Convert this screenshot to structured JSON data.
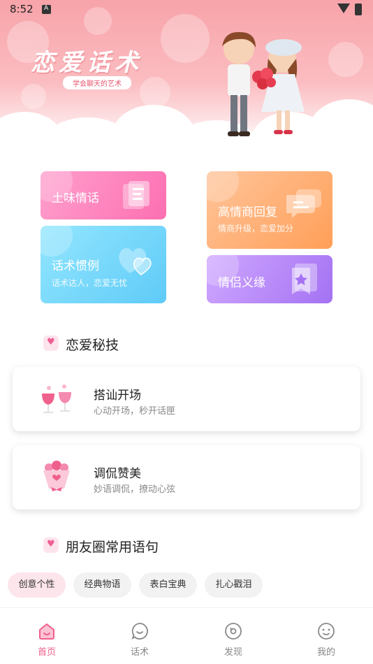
{
  "status_bar": {
    "time": "8:52"
  },
  "banner": {
    "title": "恋爱话术",
    "subtitle": "学会聊天的艺术"
  },
  "features": [
    {
      "title": "土味情话",
      "subtitle": ""
    },
    {
      "title": "高情商回复",
      "subtitle": "情商升级，恋爱加分"
    },
    {
      "title": "话术惯例",
      "subtitle": "话术达人，恋爱无忧"
    },
    {
      "title": "情侣义缘",
      "subtitle": ""
    }
  ],
  "section_tips": {
    "title": "恋爱秘技"
  },
  "tips": [
    {
      "title": "搭讪开场",
      "subtitle": "心动开场，秒开话匣",
      "icon": "wine-glasses-icon"
    },
    {
      "title": "调侃赞美",
      "subtitle": "妙语调侃，撩动心弦",
      "icon": "bouquet-icon"
    }
  ],
  "section_moments": {
    "title": "朋友圈常用语句"
  },
  "chips": [
    "创意个性",
    "经典物语",
    "表白宝典",
    "扎心戳泪"
  ],
  "nav": [
    {
      "label": "首页",
      "icon": "home-icon",
      "active": true
    },
    {
      "label": "话术",
      "icon": "chat-icon",
      "active": false
    },
    {
      "label": "发现",
      "icon": "discover-icon",
      "active": false
    },
    {
      "label": "我的",
      "icon": "profile-icon",
      "active": false
    }
  ],
  "colors": {
    "accent": "#f0608c",
    "card_pink": "#fd6fb1",
    "card_orange": "#ff9f58",
    "card_blue": "#5fcbf7",
    "card_purple": "#a472f3"
  }
}
